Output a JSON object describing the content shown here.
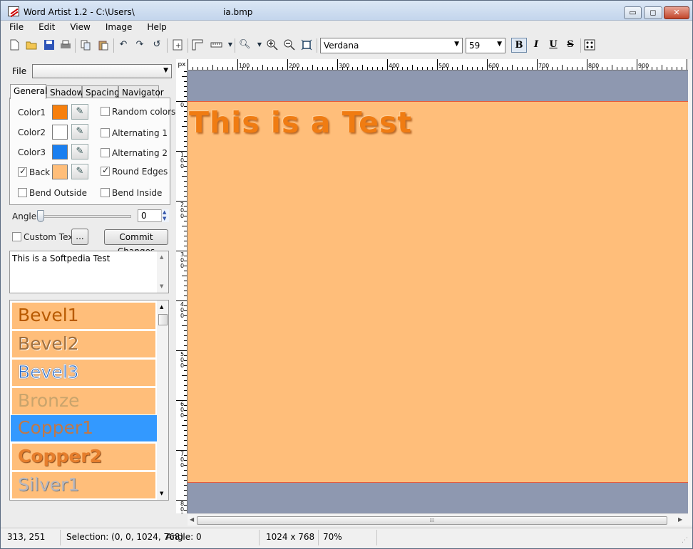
{
  "window": {
    "title": "Word Artist 1.2 - C:\\Users\\",
    "file_name": "ia.bmp",
    "controls": {
      "minimize": "▭",
      "maximize": "◻",
      "close": "✕"
    }
  },
  "menu": [
    "File",
    "Edit",
    "View",
    "Image",
    "Help"
  ],
  "toolbar": {
    "icons": [
      "new-file-icon",
      "open-folder-icon",
      "save-icon",
      "print-icon",
      "copy-icon",
      "paste-icon",
      "undo-icon",
      "redo-icon",
      "refresh-icon",
      "add-page-icon",
      "ruler-icon",
      "grid-icon",
      "zoom-icon",
      "zoom-in-icon",
      "zoom-out-icon",
      "fit-icon"
    ],
    "font_name": "Verdana",
    "font_size": "59",
    "bold": "B",
    "italic": "I",
    "underline": "U",
    "strike": "S"
  },
  "left": {
    "file_label": "File",
    "file_value": "",
    "tabs": [
      "General",
      "Shadow",
      "Spacing",
      "Navigator"
    ],
    "colors": [
      {
        "label": "Color1",
        "hex": "#f77f0c"
      },
      {
        "label": "Color2",
        "hex": "#ffffff"
      },
      {
        "label": "Color3",
        "hex": "#1a7ff0"
      },
      {
        "label": "Back",
        "hex": "#ffbe7a",
        "checked": true
      }
    ],
    "options": [
      {
        "label": "Random colors",
        "checked": false
      },
      {
        "label": "Alternating 1",
        "checked": false
      },
      {
        "label": "Alternating 2",
        "checked": false
      },
      {
        "label": "Round Edges",
        "checked": true
      },
      {
        "label": "Bend Outside",
        "checked": false
      },
      {
        "label": "Bend Inside",
        "checked": false
      }
    ],
    "angle_label": "Angle",
    "angle_value": "0",
    "custom_text_label": "Custom Text",
    "ellipsis": "...",
    "commit_label": "Commit Changes",
    "text_value": "This is a Softpedia Test",
    "styles": [
      {
        "name": "Bevel1",
        "color": "#b85a00"
      },
      {
        "name": "Bevel2",
        "color": "#a07040"
      },
      {
        "name": "Bevel3",
        "color": "#1f66c8"
      },
      {
        "name": "Bronze",
        "color": "#c9a46c"
      },
      {
        "name": "Copper1",
        "color": "#c07848"
      },
      {
        "name": "Copper2",
        "color": "#e67e2c"
      },
      {
        "name": "Silver1",
        "color": "#b8b8c0"
      }
    ],
    "selected_style": "Copper1"
  },
  "canvas": {
    "unit": "px",
    "ruler_top": [
      "100",
      "200",
      "300",
      "400",
      "500",
      "600",
      "700",
      "800",
      "900"
    ],
    "ruler_left": [
      "0",
      "100",
      "200",
      "300",
      "400",
      "500",
      "600",
      "700",
      "800"
    ],
    "art_text": "This is a Test",
    "page_color": "#ffbe7a",
    "bg_color": "#8e98b0"
  },
  "status": {
    "coords": "313, 251",
    "selection": "Selection: (0, 0, 1024, 768)",
    "angle": "Angle: 0",
    "size": "1024 x 768",
    "zoom": "70%"
  }
}
